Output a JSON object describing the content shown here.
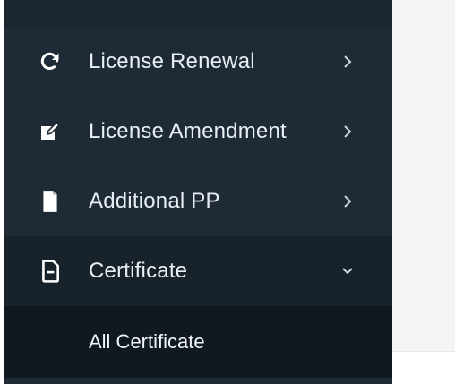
{
  "sidebar": {
    "items": [
      {
        "label": "License Renewal",
        "icon": "refresh-icon",
        "arrow": "chevron-right-icon"
      },
      {
        "label": "License Amendment",
        "icon": "edit-icon",
        "arrow": "chevron-right-icon"
      },
      {
        "label": "Additional PP",
        "icon": "document-icon",
        "arrow": "chevron-right-icon"
      },
      {
        "label": "Certificate",
        "icon": "file-icon",
        "arrow": "chevron-down-icon"
      }
    ],
    "submenu": {
      "items": [
        {
          "label": "All Certificate"
        }
      ]
    }
  },
  "colors": {
    "sidebar_bg": "#1e2b36",
    "active_bg": "#18222b",
    "submenu_bg": "#101820",
    "text": "#e8eef3"
  }
}
